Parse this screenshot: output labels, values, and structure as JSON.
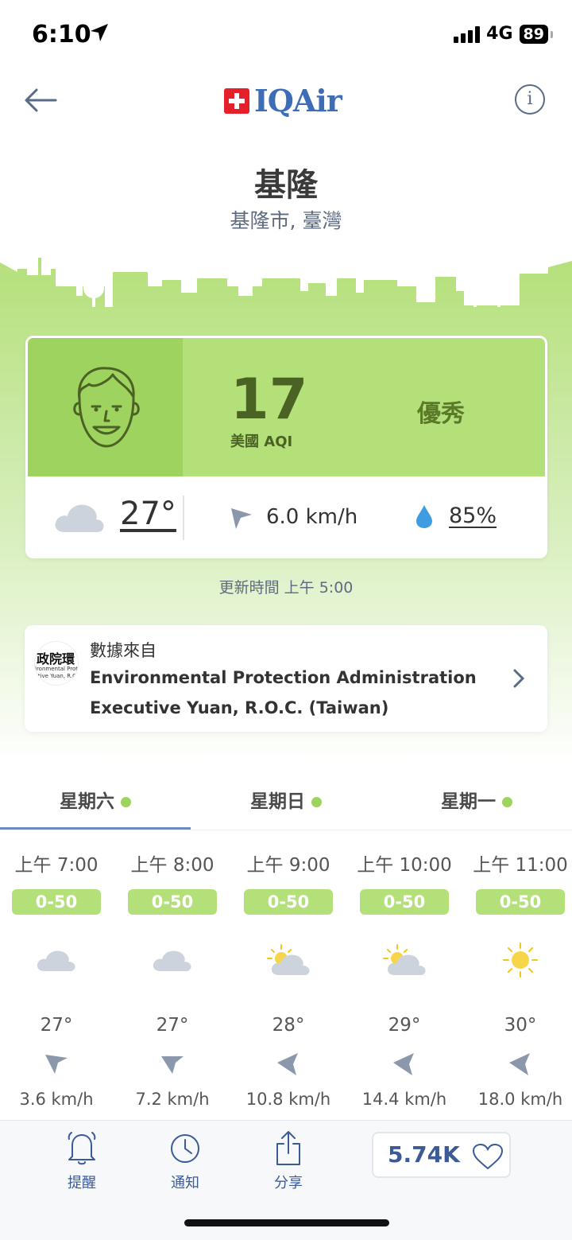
{
  "status_bar": {
    "time": "6:10",
    "network": "4G",
    "battery": "89"
  },
  "nav": {
    "logo_text": "IQAir",
    "info_label": "i"
  },
  "location": {
    "city": "基隆",
    "region": "基隆市, 臺灣"
  },
  "aqi": {
    "value": "17",
    "label": "美國 AQI",
    "status": "優秀",
    "color": "#b4e07a",
    "face_panel_color": "#9dd35e"
  },
  "weather": {
    "temperature": "27°",
    "wind": "6.0 km/h",
    "humidity": "85%",
    "icon": "cloud-icon"
  },
  "updated": "更新時間 上午 5:00",
  "source": {
    "caption": "數據來自",
    "name_line1": "Environmental Protection Administration",
    "name_line2": "Executive Yuan, R.O.C. (Taiwan)",
    "logo_line1": "政院環",
    "logo_line2": "ironmental Prote",
    "logo_line3": "ctive Yuan, R.O"
  },
  "days": [
    {
      "label": "星期六",
      "active": true
    },
    {
      "label": "星期日",
      "active": false
    },
    {
      "label": "星期一",
      "active": false
    }
  ],
  "hourly": [
    {
      "time": "上午 7:00",
      "aqi": "0-50",
      "icon": "cloud-icon",
      "temp": "27°",
      "wind": "3.6 km/h"
    },
    {
      "time": "上午 8:00",
      "aqi": "0-50",
      "icon": "cloud-icon",
      "temp": "27°",
      "wind": "7.2 km/h"
    },
    {
      "time": "上午 9:00",
      "aqi": "0-50",
      "icon": "partly-sunny-icon",
      "temp": "28°",
      "wind": "10.8 km/h"
    },
    {
      "time": "上午 10:00",
      "aqi": "0-50",
      "icon": "partly-sunny-icon",
      "temp": "29°",
      "wind": "14.4 km/h"
    },
    {
      "time": "上午 11:00",
      "aqi": "0-50",
      "icon": "sun-icon",
      "temp": "30°",
      "wind": "18.0 km/h"
    }
  ],
  "bottom_bar": {
    "alerts_label": "提醒",
    "notify_label": "通知",
    "share_label": "分享",
    "likes": "5.74K"
  }
}
